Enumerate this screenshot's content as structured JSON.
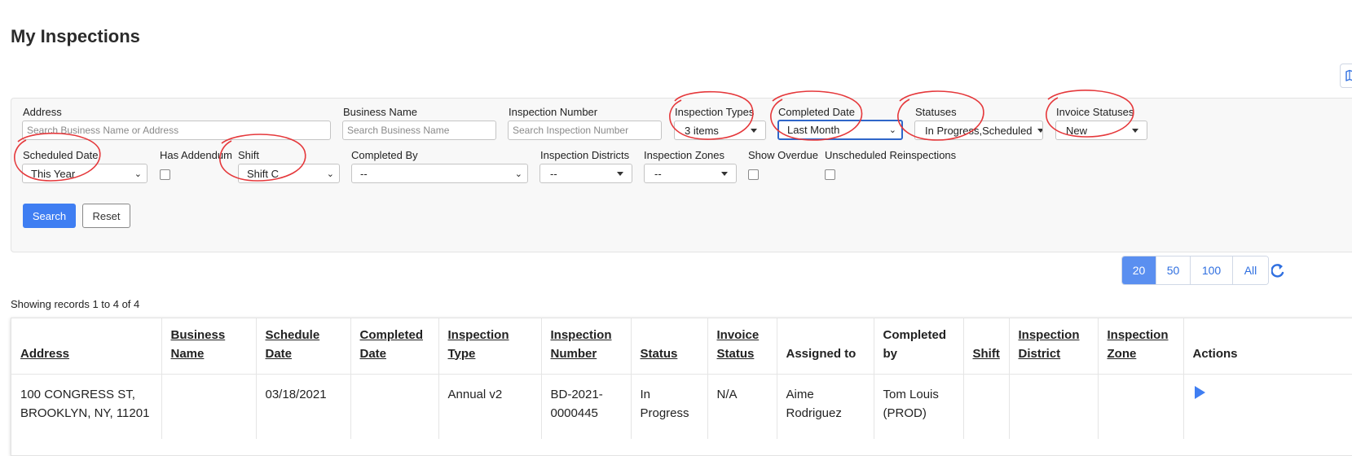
{
  "page": {
    "title": "My Inspections"
  },
  "icons": {
    "map": "map-icon",
    "refresh": "refresh-icon",
    "play": "play-icon"
  },
  "colors": {
    "primary": "#3f7ef2",
    "link": "#2f6fe0",
    "annotation": "#e5383b"
  },
  "filters": {
    "address": {
      "label": "Address",
      "placeholder": "Search Business Name or Address"
    },
    "business_name": {
      "label": "Business Name",
      "placeholder": "Search Business Name"
    },
    "inspection_number": {
      "label": "Inspection Number",
      "placeholder": "Search Inspection Number"
    },
    "inspection_types": {
      "label": "Inspection Types",
      "value": "3 items"
    },
    "completed_date": {
      "label": "Completed Date",
      "value": "Last Month"
    },
    "statuses": {
      "label": "Statuses",
      "value": "In Progress,Scheduled"
    },
    "invoice_statuses": {
      "label": "Invoice Statuses",
      "value": "New"
    },
    "scheduled_date": {
      "label": "Scheduled Date",
      "value": "This Year"
    },
    "has_addendum": {
      "label": "Has Addendum",
      "checked": false
    },
    "shift": {
      "label": "Shift",
      "value": "Shift C"
    },
    "completed_by": {
      "label": "Completed By",
      "value": "--"
    },
    "inspection_districts": {
      "label": "Inspection Districts",
      "value": "--"
    },
    "inspection_zones": {
      "label": "Inspection Zones",
      "value": "--"
    },
    "show_overdue": {
      "label": "Show Overdue",
      "checked": false
    },
    "unscheduled_reinspections": {
      "label": "Unscheduled Reinspections",
      "checked": false
    }
  },
  "buttons": {
    "search": "Search",
    "reset": "Reset"
  },
  "pagination": {
    "sizes": [
      "20",
      "50",
      "100",
      "All"
    ],
    "active": "20"
  },
  "records_text": "Showing records 1 to 4 of 4",
  "table": {
    "columns": [
      {
        "label": "Address",
        "sortable": true
      },
      {
        "label": "Business Name",
        "sortable": true
      },
      {
        "label": "Schedule Date",
        "sortable": true
      },
      {
        "label": "Completed Date",
        "sortable": true
      },
      {
        "label": "Inspection Type",
        "sortable": true
      },
      {
        "label": "Inspection Number",
        "sortable": true
      },
      {
        "label": "Status",
        "sortable": true
      },
      {
        "label": "Invoice Status",
        "sortable": true
      },
      {
        "label": "Assigned to",
        "sortable": false
      },
      {
        "label": "Completed by",
        "sortable": false
      },
      {
        "label": "Shift",
        "sortable": true
      },
      {
        "label": "Inspection District",
        "sortable": true
      },
      {
        "label": "Inspection Zone",
        "sortable": true
      },
      {
        "label": "Actions",
        "sortable": false
      }
    ],
    "rows": [
      {
        "address": "100 CONGRESS ST, BROOKLYN, NY, 11201",
        "business_name": "",
        "schedule_date": "03/18/2021",
        "completed_date": "",
        "inspection_type": "Annual v2",
        "inspection_number": "BD-2021-0000445",
        "status": "In Progress",
        "invoice_status": "N/A",
        "assigned_to": "Aime Rodriguez",
        "completed_by": "Tom Louis (PROD)",
        "shift": "",
        "inspection_district": "",
        "inspection_zone": ""
      }
    ]
  }
}
